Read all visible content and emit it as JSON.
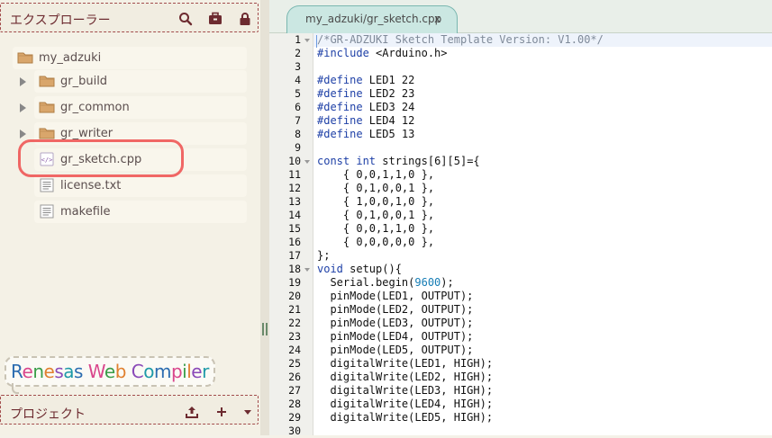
{
  "explorer": {
    "title": "エクスプローラー",
    "icons": [
      "search-icon",
      "briefcase-icon",
      "lock-icon"
    ],
    "tree": [
      {
        "name": "my_adzuki",
        "type": "folder",
        "level": 0
      },
      {
        "name": "gr_build",
        "type": "folder",
        "level": 1
      },
      {
        "name": "gr_common",
        "type": "folder",
        "level": 1
      },
      {
        "name": "gr_writer",
        "type": "folder",
        "level": 1
      },
      {
        "name": "gr_sketch.cpp",
        "type": "code-file",
        "level": 1
      },
      {
        "name": "license.txt",
        "type": "text-file",
        "level": 1
      },
      {
        "name": "makefile",
        "type": "text-file",
        "level": 1
      }
    ]
  },
  "logo": {
    "text": "Renesas Web Compiler",
    "colors": [
      "#2b6cb0",
      "#d9468c",
      "#3a9d49",
      "#e0802f",
      "#8a49b8",
      "#1e9aa8"
    ]
  },
  "project": {
    "title": "プロジェクト",
    "icons": [
      "upload-icon",
      "plus-icon",
      "caret-down-icon"
    ]
  },
  "editor": {
    "tab_label": "my_adzuki/gr_sketch.cpp",
    "tab_close": "x",
    "lines": [
      "/*GR-ADZUKI Sketch Template Version: V1.00*/",
      "#include <Arduino.h>",
      "",
      "#define LED1 22",
      "#define LED2 23",
      "#define LED3 24",
      "#define LED4 12",
      "#define LED5 13",
      "",
      "const int strings[6][5]={",
      "    { 0,0,1,1,0 },",
      "    { 0,1,0,0,1 },",
      "    { 1,0,0,1,0 },",
      "    { 0,1,0,0,1 },",
      "    { 0,0,1,1,0 },",
      "    { 0,0,0,0,0 },",
      "};",
      "void setup(){",
      "  Serial.begin(9600);",
      "  pinMode(LED1, OUTPUT);",
      "  pinMode(LED2, OUTPUT);",
      "  pinMode(LED3, OUTPUT);",
      "  pinMode(LED4, OUTPUT);",
      "  pinMode(LED5, OUTPUT);",
      "  digitalWrite(LED1, HIGH);",
      "  digitalWrite(LED2, HIGH);",
      "  digitalWrite(LED3, HIGH);",
      "  digitalWrite(LED4, HIGH);",
      "  digitalWrite(LED5, HIGH);",
      ""
    ],
    "fold_lines": [
      1,
      10,
      18
    ]
  }
}
